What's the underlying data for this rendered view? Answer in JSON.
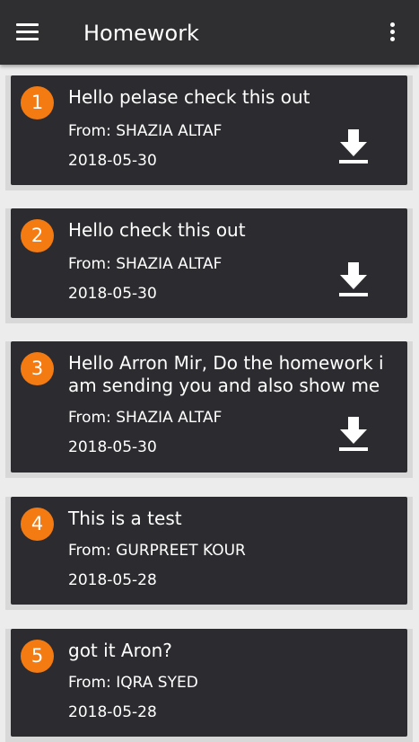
{
  "appbar": {
    "title": "Homework",
    "menu_icon": "hamburger-menu-icon",
    "overflow_icon": "more-vertical-icon"
  },
  "colors": {
    "appbar": "#2f2f32",
    "card": "#2c2c30",
    "badge": "#f47a12",
    "background": "#ececec"
  },
  "homework": [
    {
      "number": "1",
      "message": "Hello pelase check this out",
      "from": "From: SHAZIA ALTAF",
      "date": "2018-05-30",
      "has_attachment": true
    },
    {
      "number": "2",
      "message": "Hello check this out",
      "from": "From: SHAZIA ALTAF",
      "date": "2018-05-30",
      "has_attachment": true
    },
    {
      "number": "3",
      "message": "Hello Arron Mir, Do the homework i am sending you and also show me",
      "from": "From: SHAZIA ALTAF",
      "date": "2018-05-30",
      "has_attachment": true
    },
    {
      "number": "4",
      "message": "This is a test",
      "from": "From: GURPREET KOUR",
      "date": "2018-05-28",
      "has_attachment": false
    },
    {
      "number": "5",
      "message": "got it Aron?",
      "from": "From: IQRA SYED",
      "date": "2018-05-28",
      "has_attachment": false
    }
  ]
}
